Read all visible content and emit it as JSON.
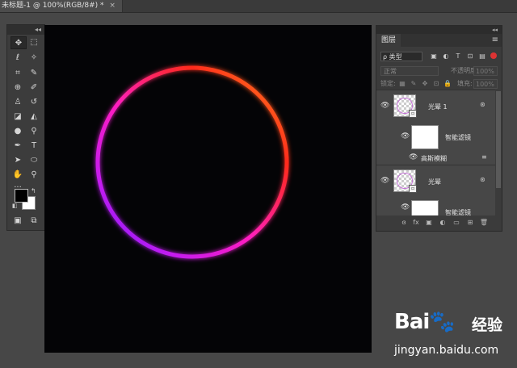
{
  "document_tab": {
    "title": "未标题-1 @ 100%(RGB/8#) *",
    "close": "×"
  },
  "toolbar": {
    "collapse": "◂◂",
    "tools": [
      {
        "name": "move-tool-icon",
        "glyph": "✥"
      },
      {
        "name": "marquee-tool-icon",
        "glyph": "⬚"
      },
      {
        "name": "lasso-tool-icon",
        "glyph": "ℓ"
      },
      {
        "name": "magic-wand-icon",
        "glyph": "✧"
      },
      {
        "name": "crop-tool-icon",
        "glyph": "⌗"
      },
      {
        "name": "eyedropper-icon",
        "glyph": "✎"
      },
      {
        "name": "healing-brush-icon",
        "glyph": "⊕"
      },
      {
        "name": "brush-tool-icon",
        "glyph": "✐"
      },
      {
        "name": "clone-stamp-icon",
        "glyph": "♙"
      },
      {
        "name": "history-brush-icon",
        "glyph": "↺"
      },
      {
        "name": "eraser-icon",
        "glyph": "◪"
      },
      {
        "name": "paint-bucket-icon",
        "glyph": "◭"
      },
      {
        "name": "blur-tool-icon",
        "glyph": "●"
      },
      {
        "name": "dodge-tool-icon",
        "glyph": "⚲"
      },
      {
        "name": "pen-tool-icon",
        "glyph": "✒"
      },
      {
        "name": "type-tool-icon",
        "glyph": "T"
      },
      {
        "name": "path-select-icon",
        "glyph": "➤"
      },
      {
        "name": "ellipse-tool-icon",
        "glyph": "⬭"
      },
      {
        "name": "hand-tool-icon",
        "glyph": "✋"
      },
      {
        "name": "zoom-tool-icon",
        "glyph": "⚲"
      },
      {
        "name": "more-tools-icon",
        "glyph": "···"
      }
    ],
    "switch_colors": "↰",
    "default_colors": "◧",
    "quick_mask": "▣",
    "screen_mode": "⧉"
  },
  "layers_panel": {
    "collapse": "◂◂",
    "tab_label": "图层",
    "menu": "≡",
    "filter": {
      "kind": "ρ 类型",
      "buttons": [
        "▣",
        "◐",
        "T",
        "⊡",
        "▤"
      ]
    },
    "blend_mode": "正常",
    "opacity_label": "不透明度:",
    "opacity_value": "100%",
    "lock_label": "锁定:",
    "lock_buttons": [
      "▦",
      "✎",
      "✥",
      "⊡",
      "🔒"
    ],
    "fill_label": "填充:",
    "fill_value": "100%",
    "layers": [
      {
        "name": "光晕 1",
        "filter_badge": "⊛",
        "visible": true
      },
      {
        "name": "智能滤镜",
        "visible": true
      },
      {
        "name": "高斯模糊",
        "visible": true,
        "options": "≡"
      },
      {
        "name": "光晕",
        "filter_badge": "⊛",
        "visible": true
      },
      {
        "name": "智能滤镜",
        "visible": true
      }
    ],
    "footer_buttons": [
      "ɞ",
      "fx",
      "▣",
      "◐",
      "▭",
      "⊞",
      "🗑"
    ]
  },
  "watermark": {
    "brand": "Bai🐾",
    "cn": "经验",
    "url": "jingyan.baidu.com"
  },
  "canvas": {
    "ring_gradient": [
      "#ff8c1a",
      "#ff2a1a",
      "#ff1fbf",
      "#c41bf0",
      "#6a1aff"
    ]
  }
}
